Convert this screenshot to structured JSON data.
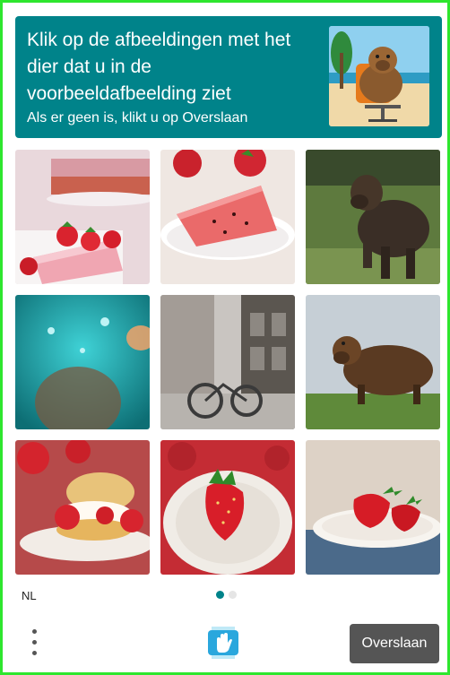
{
  "header": {
    "prompt": "Klik op de afbeeldingen met het dier dat u in de voorbeeldafbeelding ziet",
    "subprompt": "Als er geen is, klikt u op Overslaan",
    "example_image_icon": "capybara-in-office-chair-on-beach"
  },
  "grid": {
    "tiles": [
      {
        "icon": "strawberry-cake"
      },
      {
        "icon": "watermelon-cake-slice"
      },
      {
        "icon": "capybara"
      },
      {
        "icon": "blurry-teal-underwater"
      },
      {
        "icon": "blurry-street-bicycle"
      },
      {
        "icon": "capybara-on-grass"
      },
      {
        "icon": "strawberry-shortcake"
      },
      {
        "icon": "strawberry-on-plate"
      },
      {
        "icon": "strawberries-on-plate"
      }
    ]
  },
  "footer": {
    "language": "NL",
    "pagination": {
      "current": 1,
      "total": 2
    },
    "menu_icon": "more-vertical-icon",
    "logo_icon": "hcaptcha-logo-icon",
    "skip_label": "Overslaan"
  },
  "colors": {
    "accent": "#00838a",
    "frame": "#2ee62e",
    "button": "#555555"
  }
}
